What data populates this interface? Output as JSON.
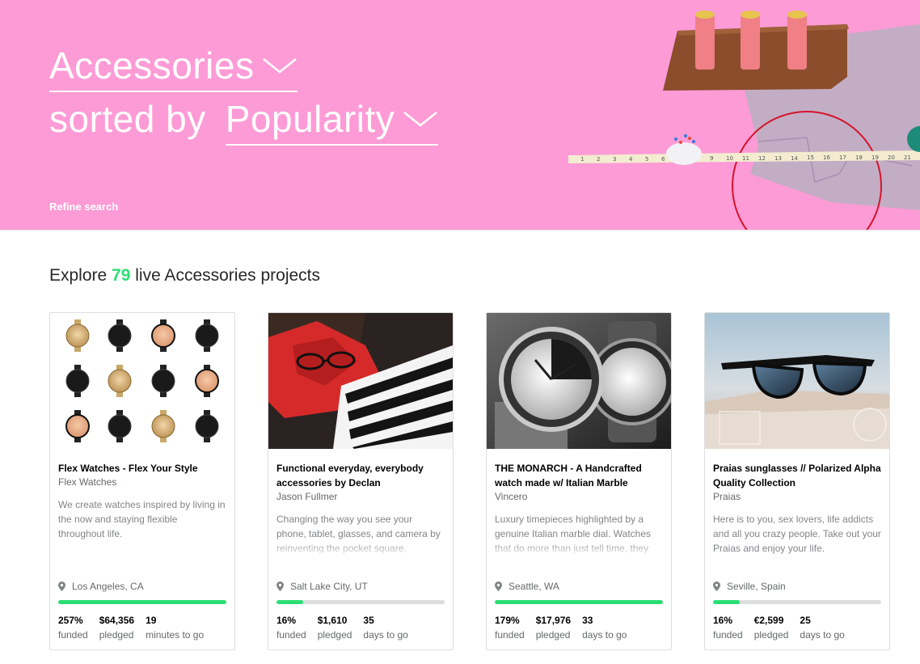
{
  "hero": {
    "category": "Accessories",
    "sorted_by_label": "sorted by",
    "sort": "Popularity",
    "refine": "Refine search"
  },
  "explore": {
    "prefix": "Explore",
    "count": "79",
    "suffix": "live Accessories projects"
  },
  "cards": [
    {
      "title": "Flex Watches - Flex Your Style",
      "creator": "Flex Watches",
      "blurb": "We create watches inspired by living in the now and staying flexible throughout life.",
      "location": "Los Angeles, CA",
      "progress": 1.0,
      "funded": "257%",
      "funded_label": "funded",
      "pledged": "$64,356",
      "pledged_label": "pledged",
      "time": "19",
      "time_label": "minutes to go"
    },
    {
      "title": "Functional everyday, everybody accessories by Declan",
      "creator": "Jason Fullmer",
      "blurb": "Changing the way you see your phone, tablet, glasses, and camera by reinventing the pocket square, handkerchief, and cleaning cloth.",
      "location": "Salt Lake City, UT",
      "progress": 0.16,
      "funded": "16%",
      "funded_label": "funded",
      "pledged": "$1,610",
      "pledged_label": "pledged",
      "time": "35",
      "time_label": "days to go"
    },
    {
      "title": "THE MONARCH - A Handcrafted watch made w/ Italian Marble",
      "creator": "Vincero",
      "blurb": "Luxury timepieces highlighted by a genuine Italian marble dial. Watches that do more than just tell time, they tell a story.",
      "location": "Seattle, WA",
      "progress": 1.0,
      "funded": "179%",
      "funded_label": "funded",
      "pledged": "$17,976",
      "pledged_label": "pledged",
      "time": "33",
      "time_label": "days to go"
    },
    {
      "title": "Praias sunglasses // Polarized Alpha Quality Collection",
      "creator": "Praias",
      "blurb": "Here is to you, sex lovers, life addicts and all you crazy people. Take out your Praias and enjoy your life.",
      "location": "Seville, Spain",
      "progress": 0.16,
      "funded": "16%",
      "funded_label": "funded",
      "pledged": "€2,599",
      "pledged_label": "pledged",
      "time": "25",
      "time_label": "days to go"
    }
  ],
  "colors": {
    "hero_pink": "#fd9bd6",
    "accent_green": "#2bde73"
  }
}
